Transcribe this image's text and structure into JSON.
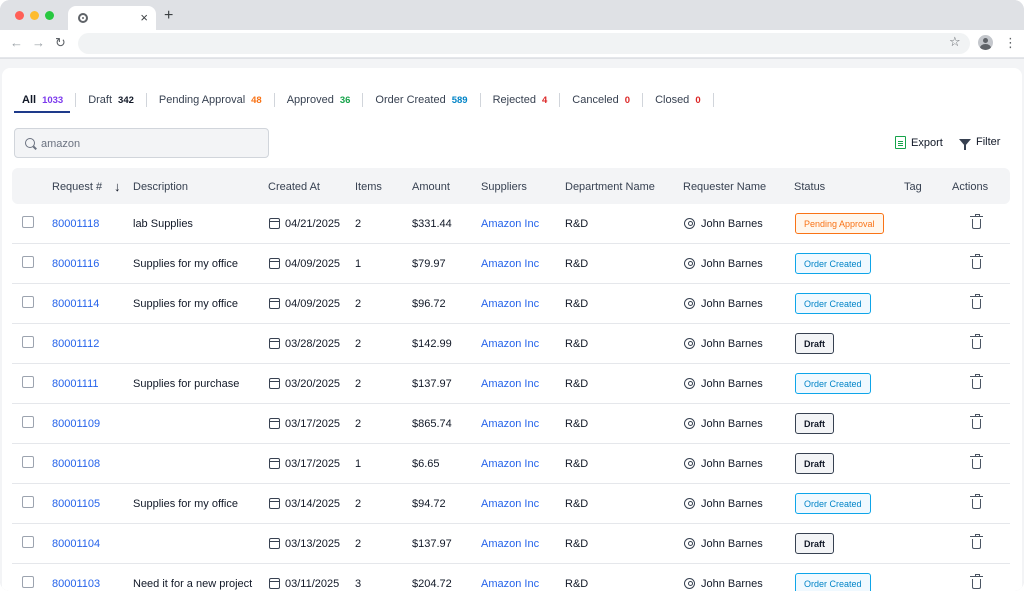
{
  "browser": {
    "tab_close": "×",
    "new_tab": "+",
    "back": "←",
    "forward": "→",
    "reload": "↻",
    "star": "☆",
    "menu": "⋮"
  },
  "filters": [
    {
      "label": "All",
      "count": "1033",
      "color": "#7c3aed",
      "active": true
    },
    {
      "label": "Draft",
      "count": "342",
      "color": "#111827"
    },
    {
      "label": "Pending Approval",
      "count": "48",
      "color": "#f97316"
    },
    {
      "label": "Approved",
      "count": "36",
      "color": "#16a34a"
    },
    {
      "label": "Order Created",
      "count": "589",
      "color": "#0284c7"
    },
    {
      "label": "Rejected",
      "count": "4",
      "color": "#dc2626"
    },
    {
      "label": "Canceled",
      "count": "0",
      "color": "#dc2626"
    },
    {
      "label": "Closed",
      "count": "0",
      "color": "#dc2626"
    }
  ],
  "search": {
    "value": "amazon"
  },
  "actions": {
    "export_label": "Export",
    "filter_label": "Filter"
  },
  "table": {
    "sort_arrow": "↓",
    "headers": {
      "request": "Request #",
      "description": "Description",
      "created_at": "Created At",
      "items": "Items",
      "amount": "Amount",
      "suppliers": "Suppliers",
      "department": "Department Name",
      "requester": "Requester Name",
      "status": "Status",
      "tag": "Tag",
      "actions": "Actions"
    },
    "rows": [
      {
        "request": "80001118",
        "description": "lab Supplies",
        "created_at": "04/21/2025",
        "items": "2",
        "amount": "$331.44",
        "supplier": "Amazon Inc",
        "department": "R&D",
        "requester": "John Barnes",
        "status": "Pending Approval",
        "status_kind": "pending"
      },
      {
        "request": "80001116",
        "description": "Supplies for my office",
        "created_at": "04/09/2025",
        "items": "1",
        "amount": "$79.97",
        "supplier": "Amazon Inc",
        "department": "R&D",
        "requester": "John Barnes",
        "status": "Order Created",
        "status_kind": "order"
      },
      {
        "request": "80001114",
        "description": "Supplies for my office",
        "created_at": "04/09/2025",
        "items": "2",
        "amount": "$96.72",
        "supplier": "Amazon Inc",
        "department": "R&D",
        "requester": "John Barnes",
        "status": "Order Created",
        "status_kind": "order"
      },
      {
        "request": "80001112",
        "description": "",
        "created_at": "03/28/2025",
        "items": "2",
        "amount": "$142.99",
        "supplier": "Amazon Inc",
        "department": "R&D",
        "requester": "John Barnes",
        "status": "Draft",
        "status_kind": "draft"
      },
      {
        "request": "80001111",
        "description": "Supplies for purchase",
        "created_at": "03/20/2025",
        "items": "2",
        "amount": "$137.97",
        "supplier": "Amazon Inc",
        "department": "R&D",
        "requester": "John Barnes",
        "status": "Order Created",
        "status_kind": "order"
      },
      {
        "request": "80001109",
        "description": "",
        "created_at": "03/17/2025",
        "items": "2",
        "amount": "$865.74",
        "supplier": "Amazon Inc",
        "department": "R&D",
        "requester": "John Barnes",
        "status": "Draft",
        "status_kind": "draft"
      },
      {
        "request": "80001108",
        "description": "",
        "created_at": "03/17/2025",
        "items": "1",
        "amount": "$6.65",
        "supplier": "Amazon Inc",
        "department": "R&D",
        "requester": "John Barnes",
        "status": "Draft",
        "status_kind": "draft"
      },
      {
        "request": "80001105",
        "description": "Supplies for my office",
        "created_at": "03/14/2025",
        "items": "2",
        "amount": "$94.72",
        "supplier": "Amazon Inc",
        "department": "R&D",
        "requester": "John Barnes",
        "status": "Order Created",
        "status_kind": "order"
      },
      {
        "request": "80001104",
        "description": "",
        "created_at": "03/13/2025",
        "items": "2",
        "amount": "$137.97",
        "supplier": "Amazon Inc",
        "department": "R&D",
        "requester": "John Barnes",
        "status": "Draft",
        "status_kind": "draft"
      },
      {
        "request": "80001103",
        "description": "Need it for a new project",
        "created_at": "03/11/2025",
        "items": "3",
        "amount": "$204.72",
        "supplier": "Amazon Inc",
        "department": "R&D",
        "requester": "John Barnes",
        "status": "Order Created",
        "status_kind": "order"
      }
    ]
  }
}
